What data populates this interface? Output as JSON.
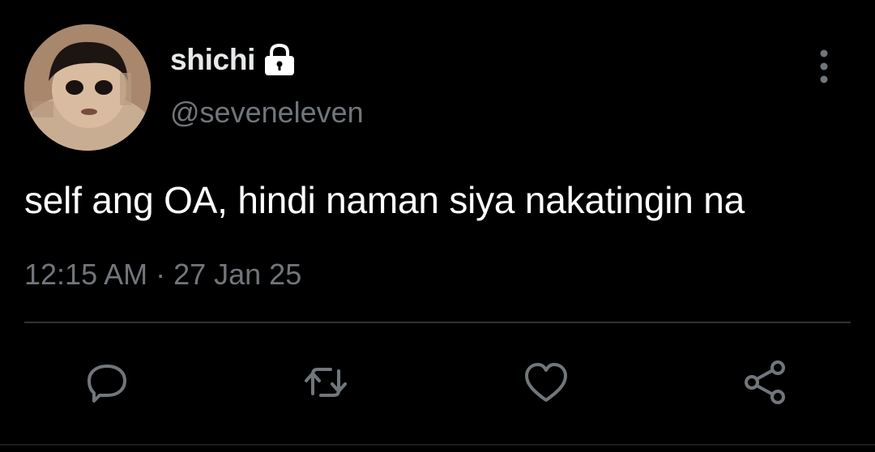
{
  "tweet": {
    "display_name": "shichi",
    "handle": "@seveneleven",
    "text": "self ang OA, hindi naman siya nakatingin na",
    "timestamp": "12:15 AM · 27 Jan 25",
    "protected_icon": "lock-icon"
  },
  "actions": {
    "reply_icon": "reply-icon",
    "retweet_icon": "retweet-icon",
    "like_icon": "heart-icon",
    "share_icon": "share-icon",
    "more_icon": "more-vertical-icon"
  },
  "colors": {
    "background": "#000000",
    "primary_text": "#e7e9ea",
    "secondary_text": "#71767b",
    "divider": "#2f3336"
  }
}
